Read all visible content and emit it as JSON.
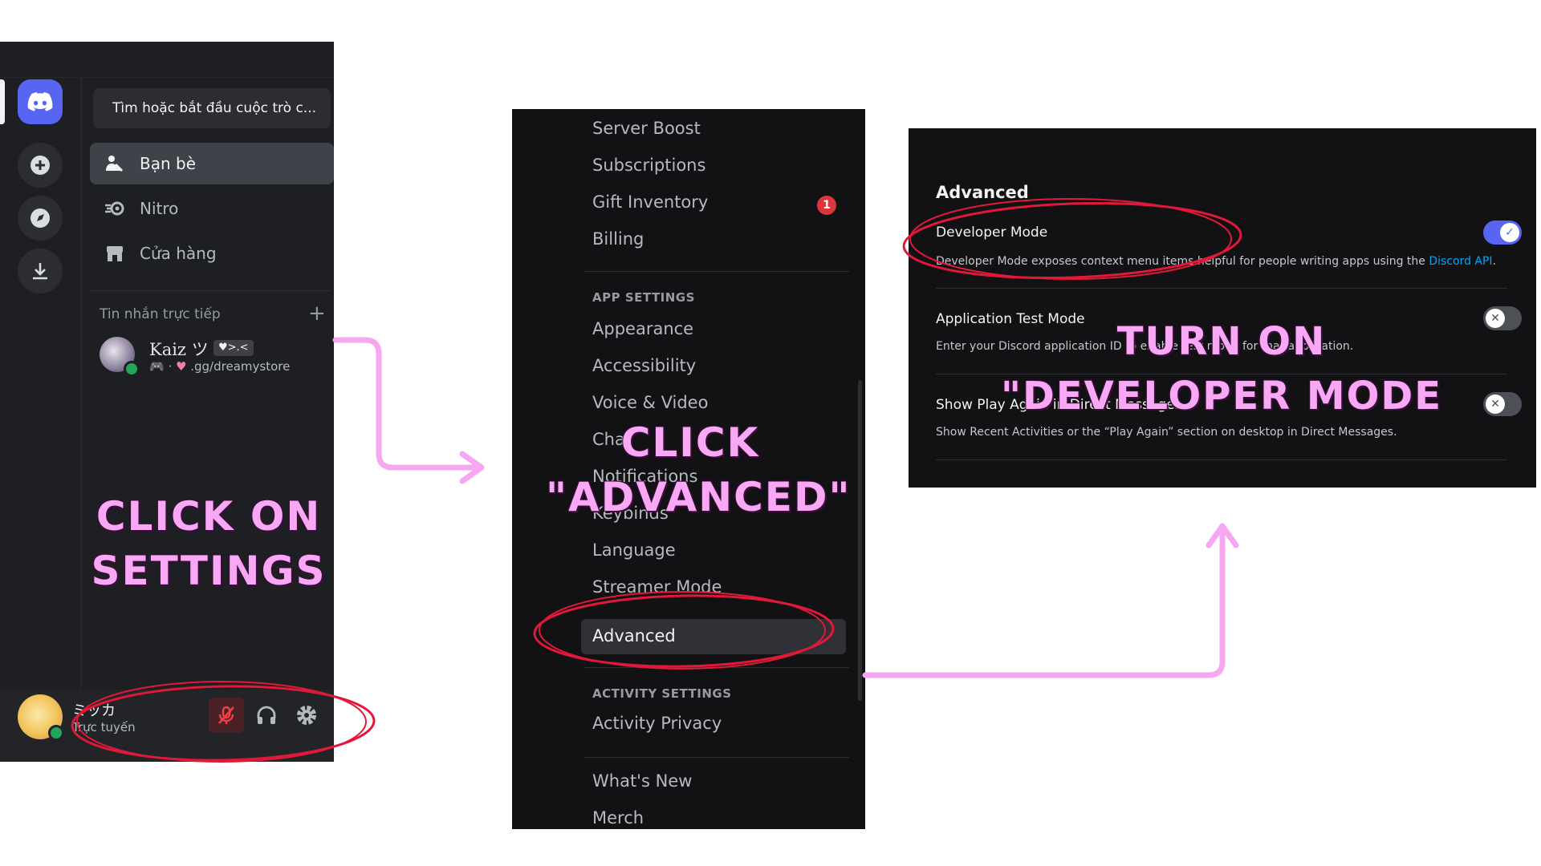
{
  "panel1": {
    "search_placeholder": "Tìm hoặc bắt đầu cuộc trò c...",
    "nav": [
      {
        "label": "Bạn bè",
        "icon": "friends-icon"
      },
      {
        "label": "Nitro",
        "icon": "nitro-icon"
      },
      {
        "label": "Cửa hàng",
        "icon": "shop-icon"
      }
    ],
    "dm_header": "Tin nhắn trực tiếp",
    "dm_add": "+",
    "dm": {
      "name": "Kaiz ツ",
      "badge": "♥>.<",
      "status_text": ".gg/dreamystore"
    },
    "user": {
      "name": "ミッカ",
      "status": "Trực tuyến"
    }
  },
  "panel2": {
    "items_top": [
      "Server Boost",
      "Subscriptions",
      "Gift Inventory",
      "Billing"
    ],
    "gift_badge": "1",
    "app_settings_header": "APP SETTINGS",
    "app_items": [
      "Appearance",
      "Accessibility",
      "Voice & Video",
      "Chat",
      "Notifications",
      "Keybinds",
      "Language",
      "Streamer Mode",
      "Advanced"
    ],
    "activity_header": "ACTIVITY SETTINGS",
    "activity_items": [
      "Activity Privacy"
    ],
    "misc_items": [
      "What's New",
      "Merch"
    ]
  },
  "panel3": {
    "title": "Advanced",
    "options": [
      {
        "title": "Developer Mode",
        "desc": "Developer Mode exposes context menu items helpful for people writing apps using the ",
        "link": "Discord API",
        "desc_end": ".",
        "enabled": true
      },
      {
        "title": "Application Test Mode",
        "desc": "Enter your Discord application ID to enable test mode for that application.",
        "enabled": false
      },
      {
        "title": "Show Play Again in Direct Messages",
        "desc": "Show Recent Activities or the “Play Again” section on desktop in Direct Messages.",
        "enabled": false
      }
    ]
  },
  "callouts": {
    "step1": [
      "CLICK ON",
      "SETTINGS"
    ],
    "step2": [
      "CLICK",
      "\"ADVANCED\""
    ],
    "step3": [
      "TURN ON",
      "\"DEVELOPER MODE"
    ]
  },
  "colors": {
    "callout": "#f9a8f5",
    "circle": "#e0193a",
    "arrow": "#f7a6f2",
    "blurple": "#5865f2"
  }
}
